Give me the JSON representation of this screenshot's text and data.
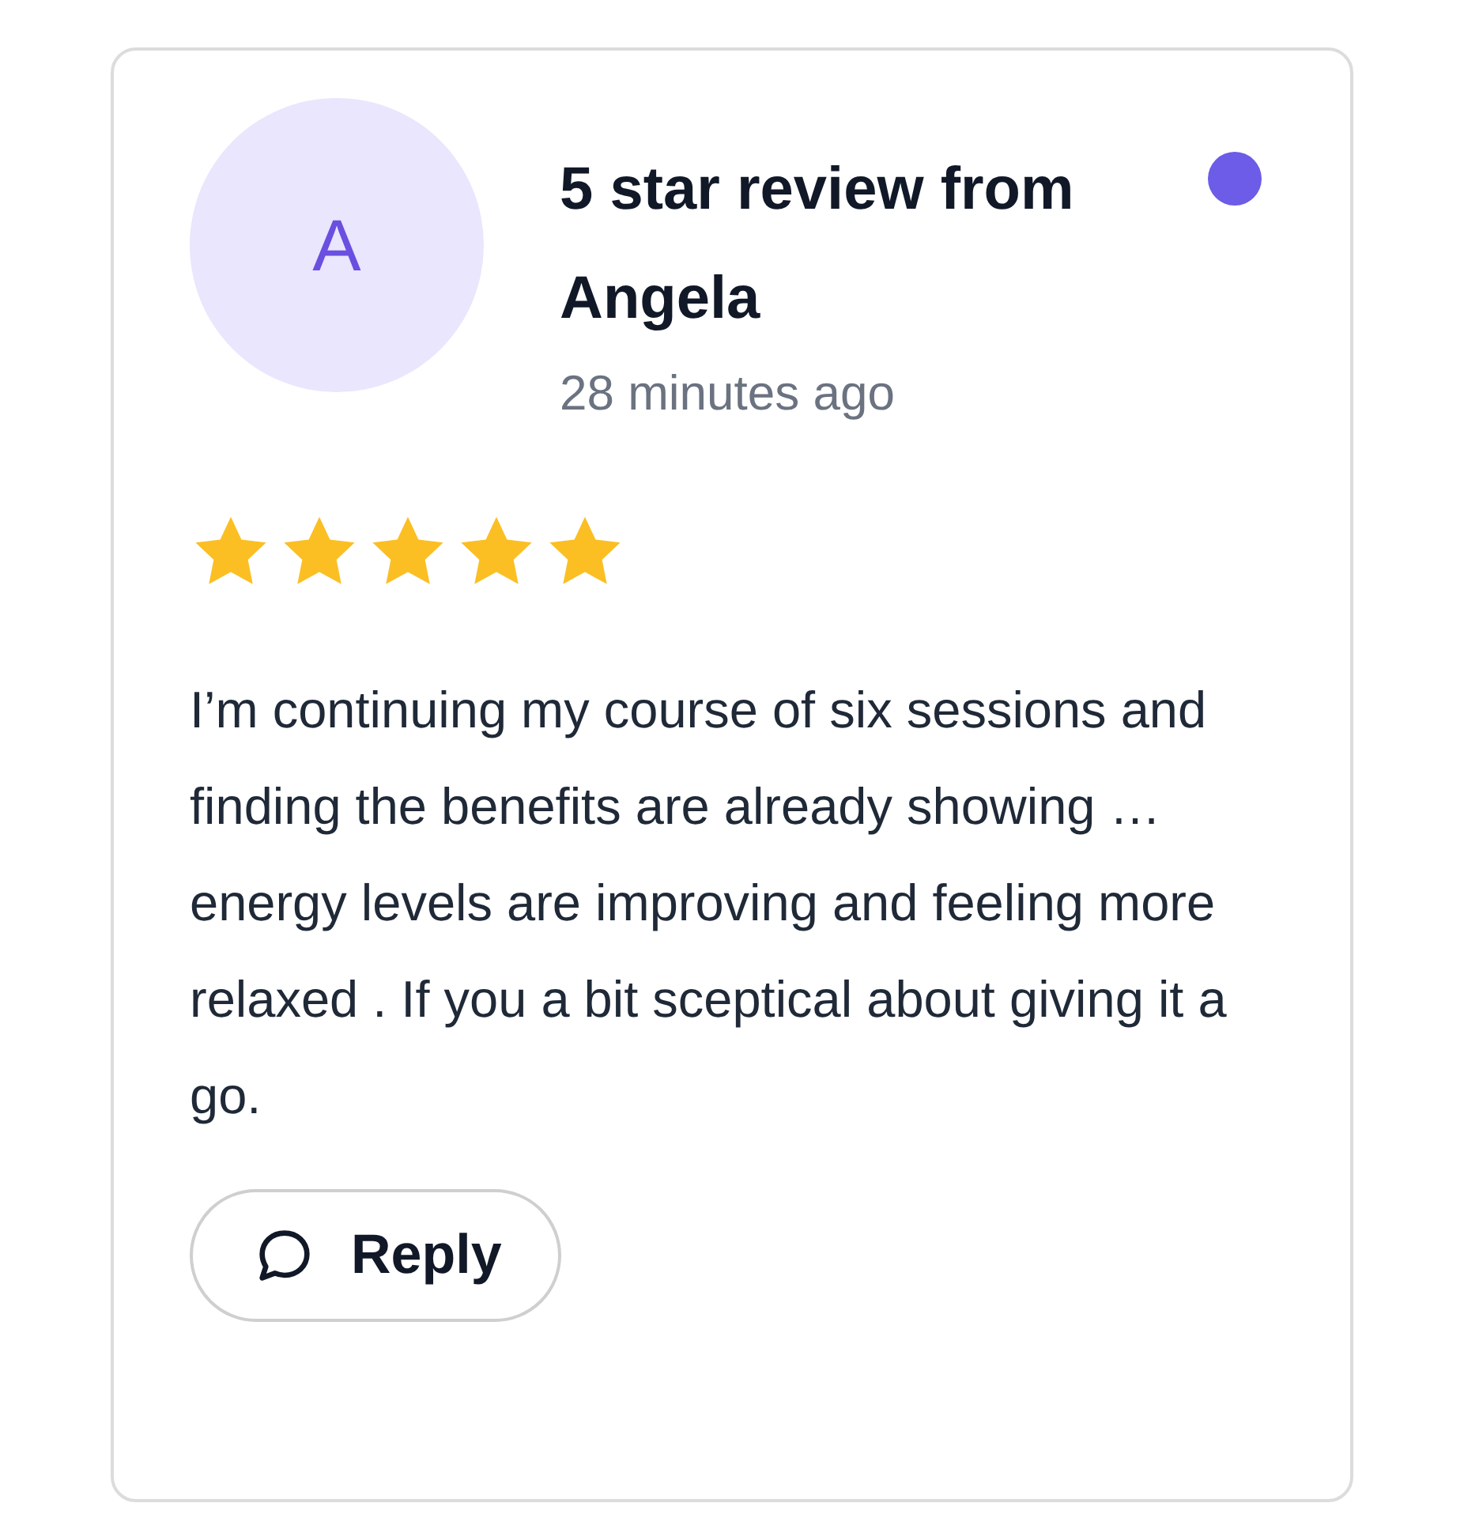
{
  "review": {
    "avatar_initial": "A",
    "title": "5 star review from Angela",
    "time": "28 minutes ago",
    "unread": true,
    "stars": 5,
    "text": "I’m continuing my course of six sessions and finding the benefits are already showing … energy levels are improving and feeling more relaxed . If you a bit sceptical about giving it a go.",
    "reply_button": "Reply"
  }
}
